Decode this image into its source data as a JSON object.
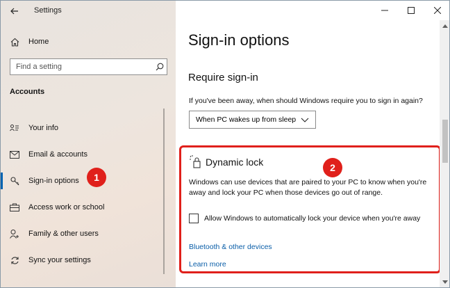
{
  "window": {
    "title": "Settings",
    "controls": [
      "minimize",
      "maximize",
      "close"
    ]
  },
  "sidebar": {
    "home_label": "Home",
    "search_placeholder": "Find a setting",
    "section_title": "Accounts",
    "items": [
      {
        "label": "Your info",
        "icon": "person-card-icon",
        "active": false
      },
      {
        "label": "Email & accounts",
        "icon": "mail-icon",
        "active": false
      },
      {
        "label": "Sign-in options",
        "icon": "key-icon",
        "active": true
      },
      {
        "label": "Access work or school",
        "icon": "briefcase-icon",
        "active": false
      },
      {
        "label": "Family & other users",
        "icon": "person-add-icon",
        "active": false
      },
      {
        "label": "Sync your settings",
        "icon": "sync-icon",
        "active": false
      }
    ]
  },
  "main": {
    "page_title": "Sign-in options",
    "require_signin": {
      "heading": "Require sign-in",
      "question": "If you've been away, when should Windows require you to sign in again?",
      "selected": "When PC wakes up from sleep"
    },
    "dynamic_lock": {
      "heading": "Dynamic lock",
      "description": "Windows can use devices that are paired to your PC to know when you're away and lock your PC when those devices go out of range.",
      "checkbox_label": "Allow Windows to automatically lock your device when you're away",
      "checked": false,
      "link_bluetooth": "Bluetooth & other devices",
      "link_learn_more": "Learn more"
    }
  },
  "annotations": {
    "badge_1": "1",
    "badge_2": "2"
  },
  "colors": {
    "accent": "#0063b1",
    "link": "#0a5ea8",
    "highlight_red": "#e0201b"
  }
}
